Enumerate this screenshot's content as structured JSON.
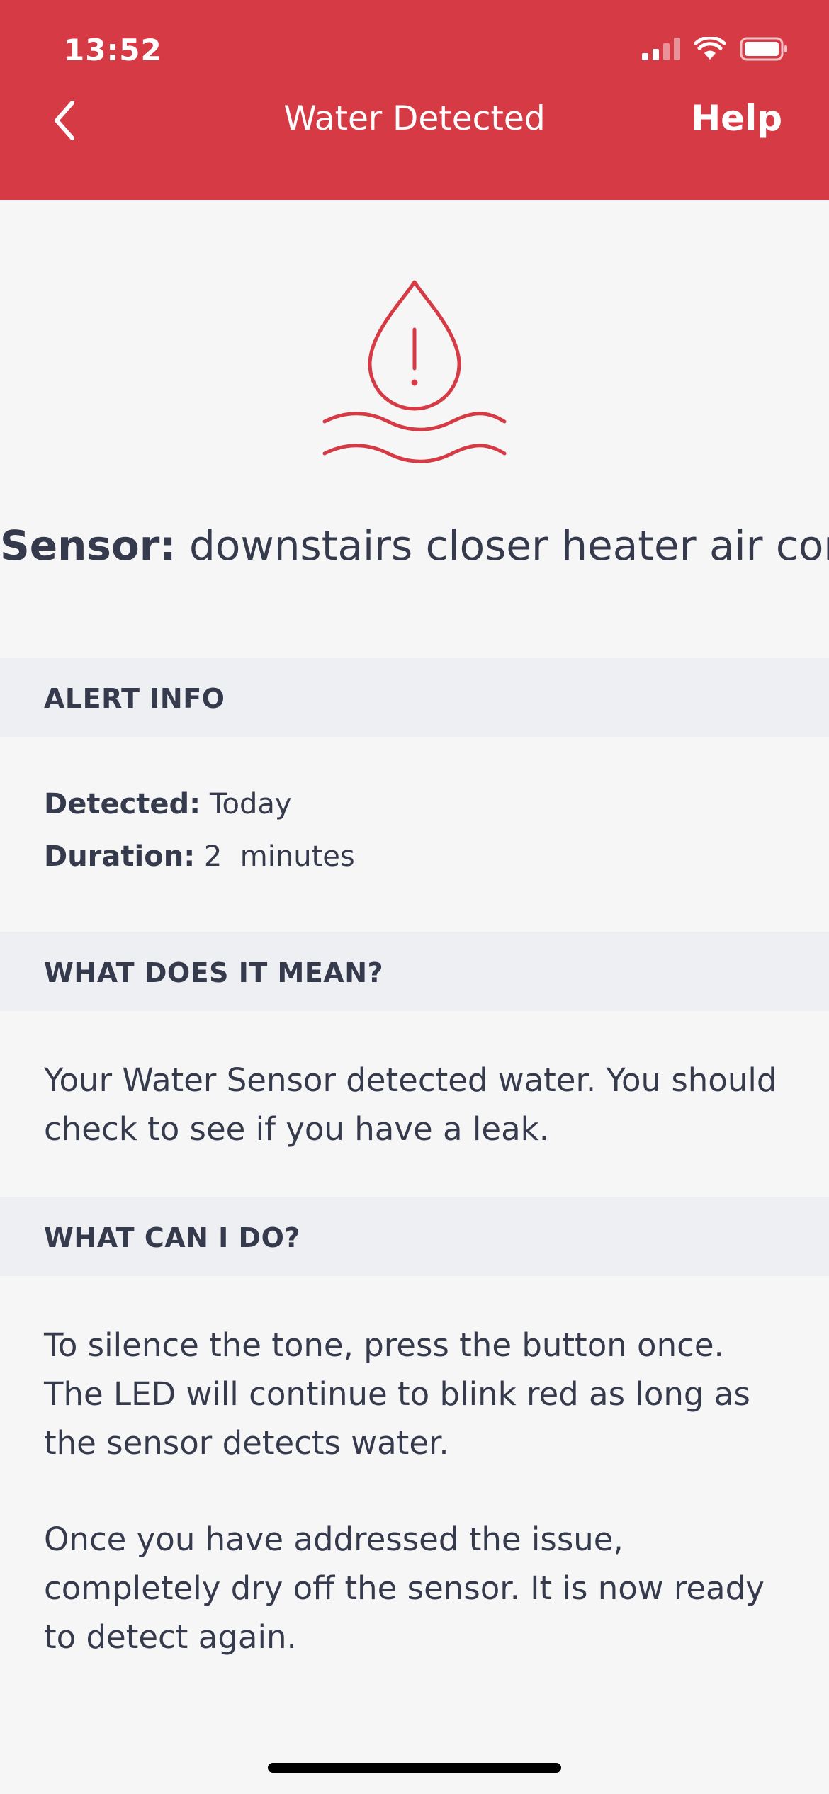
{
  "status_bar": {
    "time": "13:52"
  },
  "nav": {
    "title": "Water Detected",
    "help_label": "Help"
  },
  "sensor": {
    "label": "Sensor:",
    "name": "downstairs closer heater air cond"
  },
  "alert_info": {
    "heading": "ALERT INFO",
    "detected_label": "Detected:",
    "detected_value": "Today",
    "duration_label": "Duration:",
    "duration_value": "2  minutes"
  },
  "meaning": {
    "heading": "WHAT DOES IT MEAN?",
    "text": "Your Water Sensor detected water. You should check to see if you have a leak."
  },
  "actions": {
    "heading": "WHAT CAN I DO?",
    "paragraph_1": "To silence the tone, press the button once. The LED will continue to blink red as long as the sensor detects water.",
    "paragraph_2": "Once you have addressed the issue, completely dry off the sensor. It is now ready to detect again."
  },
  "colors": {
    "header_bg": "#d63a45",
    "accent": "#d63a45",
    "section_bg": "#eeeff3",
    "text": "#363a4d",
    "page_bg": "#f6f6f6"
  },
  "icons": {
    "back": "chevron-left-icon",
    "illustration": "water-drop-alert-icon",
    "signal": "cellular-signal-icon",
    "wifi": "wifi-icon",
    "battery": "battery-icon"
  }
}
